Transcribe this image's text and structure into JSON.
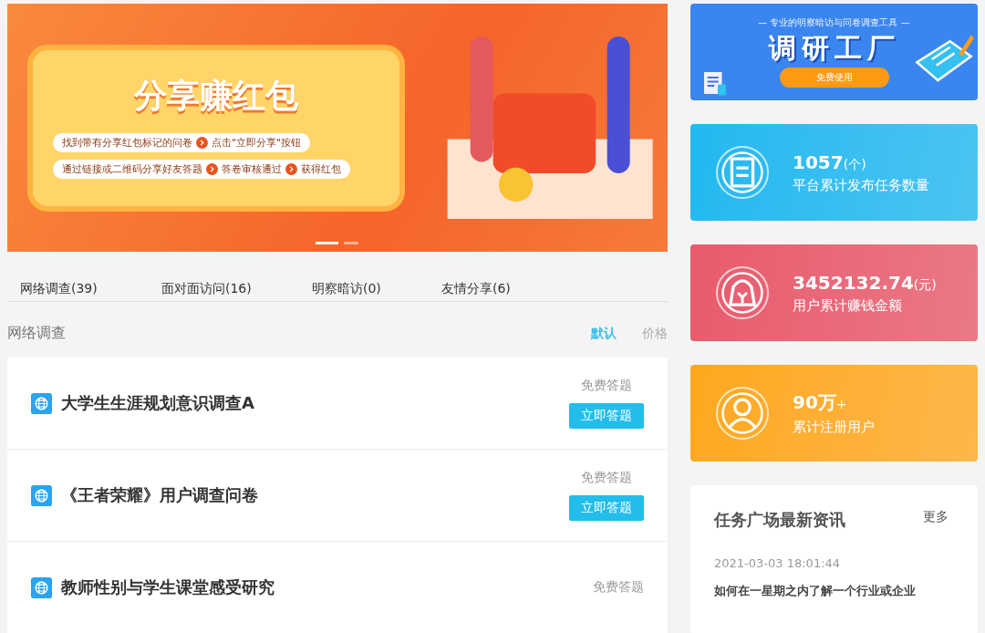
{
  "banner": {
    "headline": "分享赚红包",
    "steps": [
      {
        "items": [
          "找到带有分享红包标记的问卷",
          "点击\"立即分享\"按钮"
        ]
      },
      {
        "items": [
          "通过链接或二维码分享好友答题",
          "答卷审核通过",
          "获得红包"
        ]
      }
    ],
    "dots": [
      {
        "selected": true
      },
      {
        "selected": false
      }
    ]
  },
  "tabs": [
    {
      "label": "网络调查(39)"
    },
    {
      "label": "面对面访问(16)"
    },
    {
      "label": "明察暗访(0)"
    },
    {
      "label": "友情分享(6)"
    }
  ],
  "section": {
    "title": "网络调查",
    "sort": [
      {
        "label": "默认",
        "selected": true
      },
      {
        "label": "价格",
        "selected": false
      }
    ]
  },
  "surveys": [
    {
      "title": "大学生生涯规划意识调查A",
      "price": "免费答题",
      "button": "立即答题"
    },
    {
      "title": "《王者荣耀》用户调查问卷",
      "price": "免费答题",
      "button": "立即答题"
    },
    {
      "title": "教师性别与学生课堂感受研究",
      "price": "免费答题"
    }
  ],
  "ad": {
    "tagline": "— 专业的明察暗访与问卷调查工具 —",
    "title": "调研工厂",
    "button": "免费使用"
  },
  "stats": [
    {
      "kind": "tasks",
      "value": "1057",
      "unit": "(个)",
      "label": "平台累计发布任务数量",
      "color": "#22b8f0"
    },
    {
      "kind": "money",
      "value": "3452132.74",
      "unit": "(元)",
      "label": "用户累计赚钱金额",
      "color": "#e85a6c"
    },
    {
      "kind": "users",
      "value": "90万",
      "unit": "+",
      "label": "累计注册用户",
      "color": "#ffa820"
    }
  ],
  "news": {
    "title": "任务广场最新资讯",
    "more": "更多",
    "date": "2021-03-03 18:01:44",
    "item": "如何在一星期之内了解一个行业或企业"
  }
}
